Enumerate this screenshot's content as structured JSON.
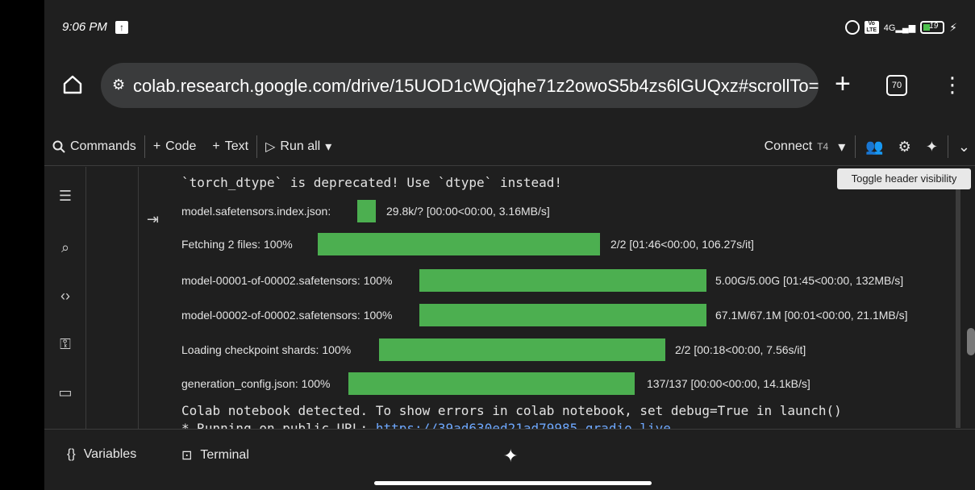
{
  "status_bar": {
    "time": "9:06 PM",
    "signal": "4G",
    "battery": "19"
  },
  "browser": {
    "url": "colab.research.google.com/drive/15UOD1cWQjqhe71z2owoS5b4zs6lGUQxz#scrollTo=:",
    "tab_count": "70"
  },
  "toolbar": {
    "commands": "Commands",
    "code": "Code",
    "text": "Text",
    "run_all": "Run all",
    "connect": "Connect",
    "runtime": "T4"
  },
  "tooltip": "Toggle header visibility",
  "output": {
    "warning": "`torch_dtype` is deprecated! Use `dtype` instead!",
    "progress": [
      {
        "label": "model.safetensors.index.json:",
        "percent": "",
        "stat": "29.8k/? [00:00<00:00, 3.16MB/s]",
        "fill": 1.0
      },
      {
        "label": "Fetching 2 files: 100%",
        "percent": "100%",
        "stat": "2/2 [01:46<00:00, 106.27s/it]",
        "fill": 1.0
      },
      {
        "label": "model-00001-of-00002.safetensors: 100%",
        "percent": "100%",
        "stat": "5.00G/5.00G [01:45<00:00, 132MB/s]",
        "fill": 1.0
      },
      {
        "label": "model-00002-of-00002.safetensors: 100%",
        "percent": "100%",
        "stat": "67.1M/67.1M [00:01<00:00, 21.1MB/s]",
        "fill": 1.0
      },
      {
        "label": "Loading checkpoint shards: 100%",
        "percent": "100%",
        "stat": "2/2 [00:18<00:00, 7.56s/it]",
        "fill": 1.0
      },
      {
        "label": "generation_config.json: 100%",
        "percent": "100%",
        "stat": "137/137 [00:00<00:00, 14.1kB/s]",
        "fill": 1.0
      }
    ],
    "detected": "Colab notebook detected. To show errors in colab notebook, set debug=True in launch()",
    "running_prefix": "* Running on public URL: ",
    "running_url": "https://39ad630ed21ad79985.gradio.live"
  },
  "bottom_bar": {
    "variables": "Variables",
    "terminal": "Terminal"
  },
  "colors": {
    "progress_bar": "#4caf50",
    "background": "#1f1f1f",
    "link": "#6ea8fe"
  }
}
